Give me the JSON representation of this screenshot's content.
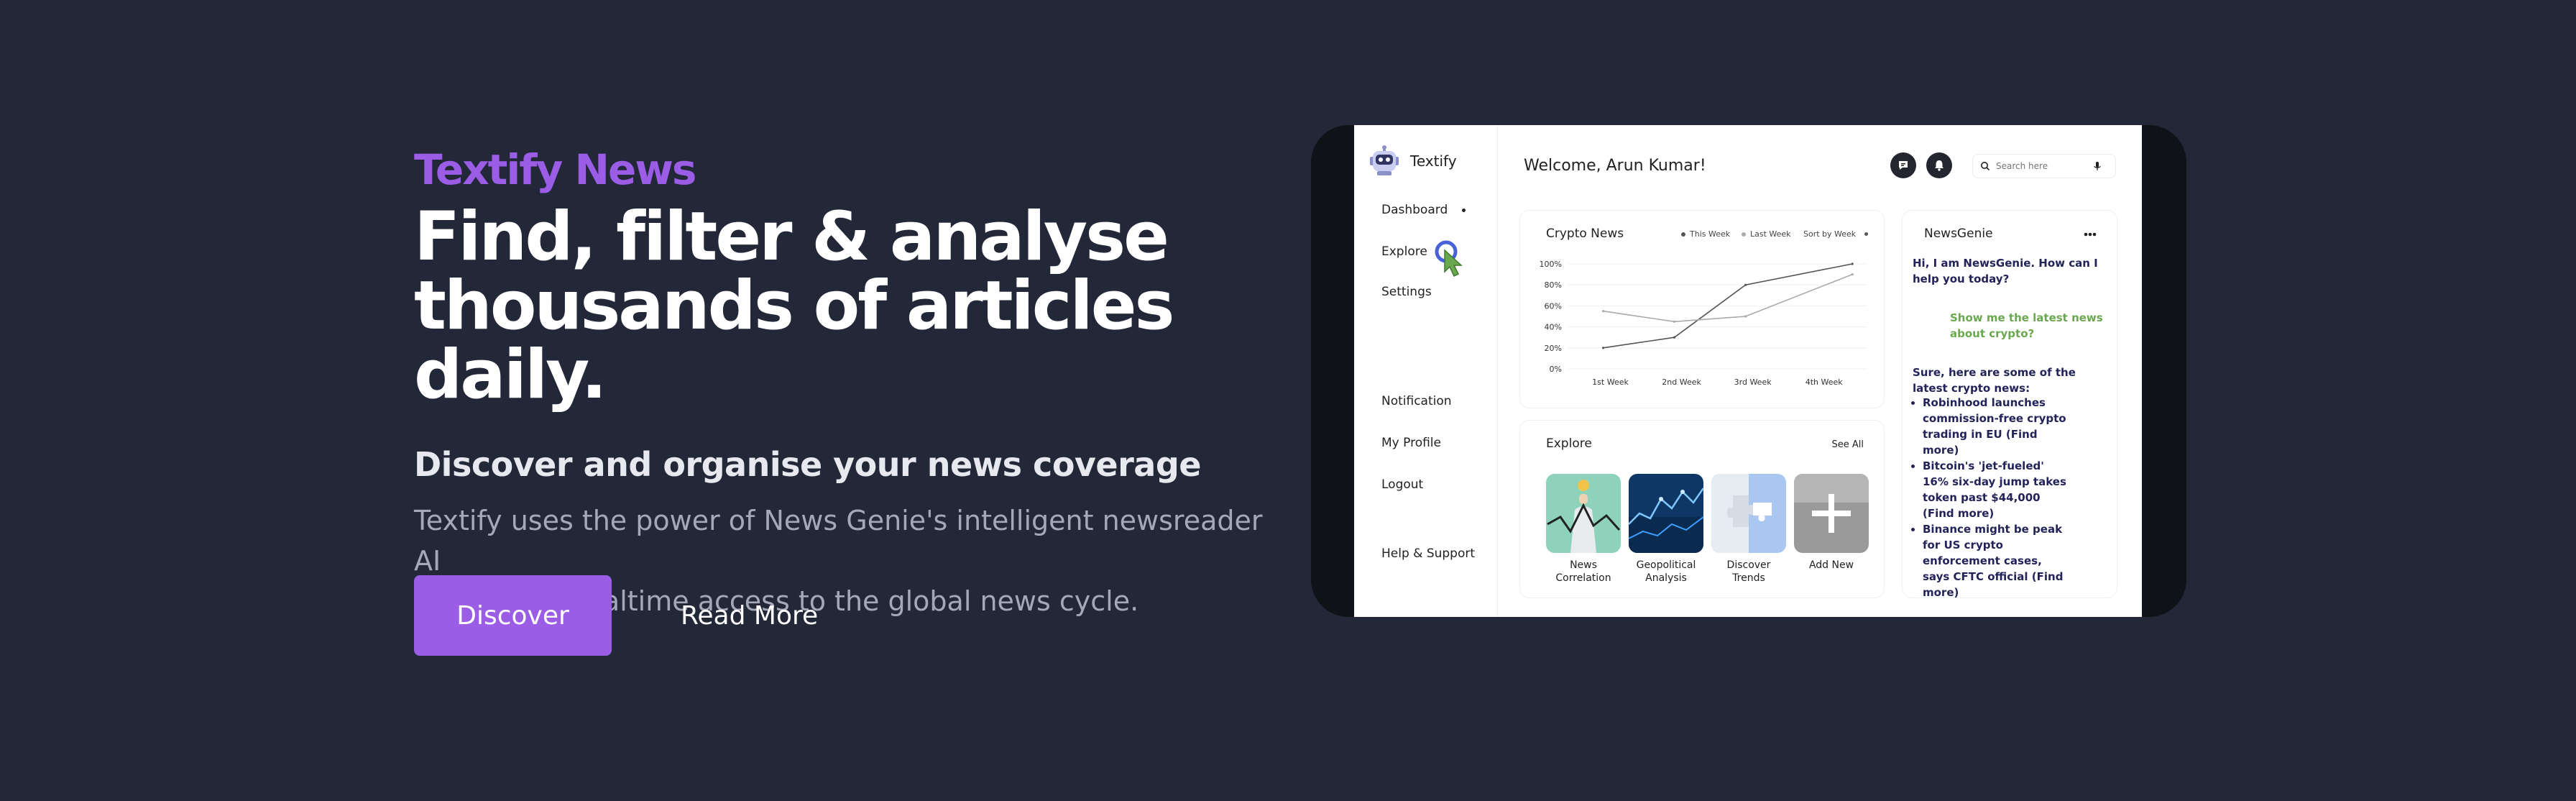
{
  "hero": {
    "brand": "Textify News",
    "headline_line1": "Find, filter & analyse",
    "headline_line2": "thousands of articles daily.",
    "subhead": "Discover and organise your news coverage",
    "desc_line1": "Textify uses the power of News Genie's intelligent newsreader AI",
    "desc_line2": "to give you realtime access to the global news cycle.",
    "discover_label": "Discover",
    "read_more_label": "Read More",
    "accent_color": "#9b5de5"
  },
  "app": {
    "logo_text": "Textify",
    "welcome": "Welcome, Arun Kumar!",
    "search_placeholder": "Search here",
    "nav": {
      "dashboard": "Dashboard",
      "explore": "Explore",
      "settings": "Settings",
      "notification": "Notification",
      "profile": "My Profile",
      "logout": "Logout",
      "help": "Help & Support"
    },
    "icons": [
      "chat-icon",
      "bell-icon",
      "search-icon",
      "mic-icon",
      "robot-logo",
      "pointer-cursor"
    ]
  },
  "crypto": {
    "title": "Crypto News",
    "legend_this": "This Week",
    "legend_last": "Last Week",
    "sort_label": "Sort by Week"
  },
  "chart_data": {
    "type": "line",
    "categories": [
      "1st Week",
      "2nd Week",
      "3rd Week",
      "4th Week"
    ],
    "y_ticks": [
      "0%",
      "20%",
      "40%",
      "60%",
      "80%",
      "100%"
    ],
    "ylim": [
      0,
      100
    ],
    "series": [
      {
        "name": "This Week",
        "x": [
          1,
          2,
          3,
          4.5
        ],
        "values": [
          20,
          30,
          80,
          100
        ],
        "color": "#555555"
      },
      {
        "name": "Last Week",
        "x": [
          1,
          2,
          3,
          4.5
        ],
        "values": [
          55,
          45,
          50,
          90
        ],
        "color": "#aaaaaa"
      }
    ]
  },
  "explore": {
    "title": "Explore",
    "see_all": "See All",
    "tiles": [
      {
        "line1": "News",
        "line2": "Correlation"
      },
      {
        "line1": "Geopolitical",
        "line2": "Analysis"
      },
      {
        "line1": "Discover",
        "line2": "Trends"
      },
      {
        "line1": "Add New",
        "line2": ""
      }
    ]
  },
  "genie": {
    "title": "NewsGenie",
    "bot_greeting_1": "Hi, I am NewsGenie. How can I",
    "bot_greeting_2": "help you today?",
    "user_msg_1": "Show me the latest news",
    "user_msg_2": "about crypto?",
    "bot_reply_1": "Sure, here are some of the",
    "bot_reply_2": "latest crypto news:",
    "items": [
      "Robinhood launches commission-free crypto trading in EU (Find more)",
      "Bitcoin's 'jet-fueled' 16% six-day jump takes token past $44,000 (Find more)",
      "Binance might be peak for US crypto enforcement cases, says CFTC official (Find more)"
    ]
  }
}
